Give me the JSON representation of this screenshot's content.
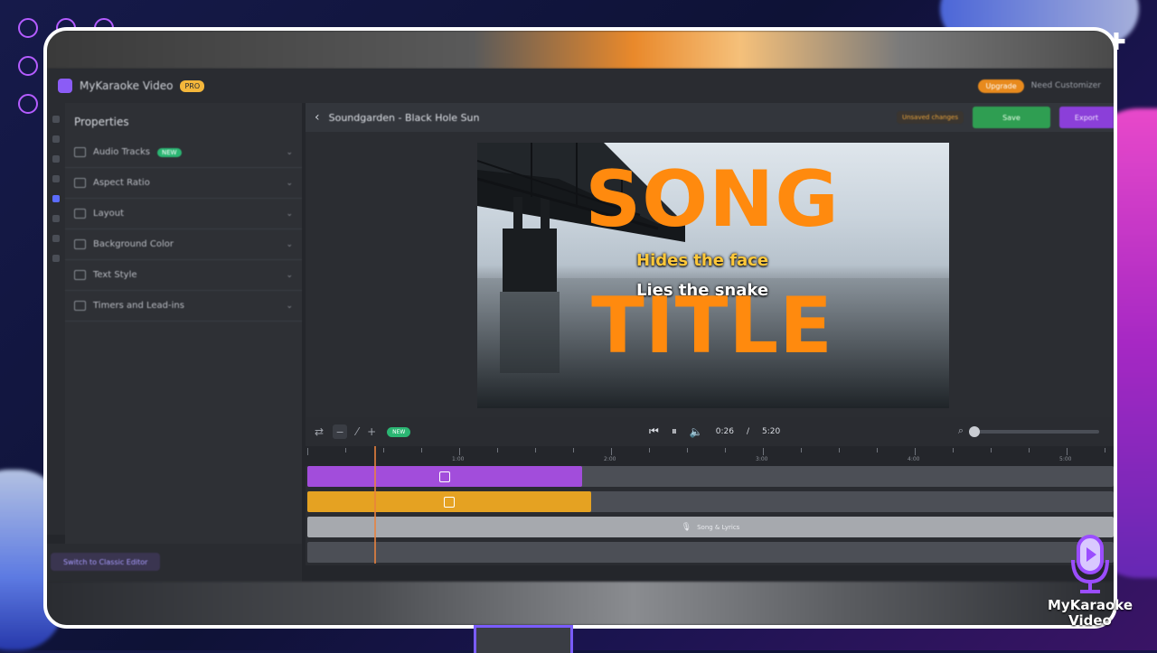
{
  "app": {
    "name": "MyKaraoke Video",
    "badge": "PRO",
    "upgrade_label": "Upgrade",
    "account_text": "Need Customizer"
  },
  "sidebar": {
    "title": "Properties",
    "items": [
      {
        "label": "Audio Tracks",
        "badge": "NEW",
        "icon": "music-icon"
      },
      {
        "label": "Aspect Ratio",
        "badge": "",
        "icon": "aspect-icon"
      },
      {
        "label": "Layout",
        "badge": "",
        "icon": "layout-icon"
      },
      {
        "label": "Background Color",
        "badge": "",
        "icon": "palette-icon"
      },
      {
        "label": "Text Style",
        "badge": "",
        "icon": "text-icon"
      },
      {
        "label": "Timers and Lead-ins",
        "badge": "",
        "icon": "timer-icon"
      }
    ],
    "footer_button": "Switch to Classic Editor"
  },
  "editor": {
    "song_title": "Soundgarden - Black Hole Sun",
    "warning": "Unsaved changes",
    "save_label": "Save",
    "export_label": "Export"
  },
  "preview": {
    "title_top": "SONG",
    "title_bottom": "TITLE",
    "lyric_line_1": "Hides the face",
    "lyric_line_2": "Lies the snake",
    "title_color": "#ff8a0e",
    "highlight_color": "#ffc83a"
  },
  "playback": {
    "current_time": "0:26",
    "separator": "/",
    "total_time": "5:20",
    "chip": "NEW",
    "volume_level": 0
  },
  "timeline": {
    "ticks": [
      "1:00",
      "2:00",
      "3:00",
      "4:00",
      "5:00"
    ],
    "track_3_label": "Song & Lyrics",
    "colors": {
      "video_track": "#a24ddb",
      "lyrics_track": "#e5a222",
      "audio_track": "#a6a9ae"
    }
  },
  "brand": {
    "line1": "MyKaraoke",
    "line2": "Video"
  }
}
